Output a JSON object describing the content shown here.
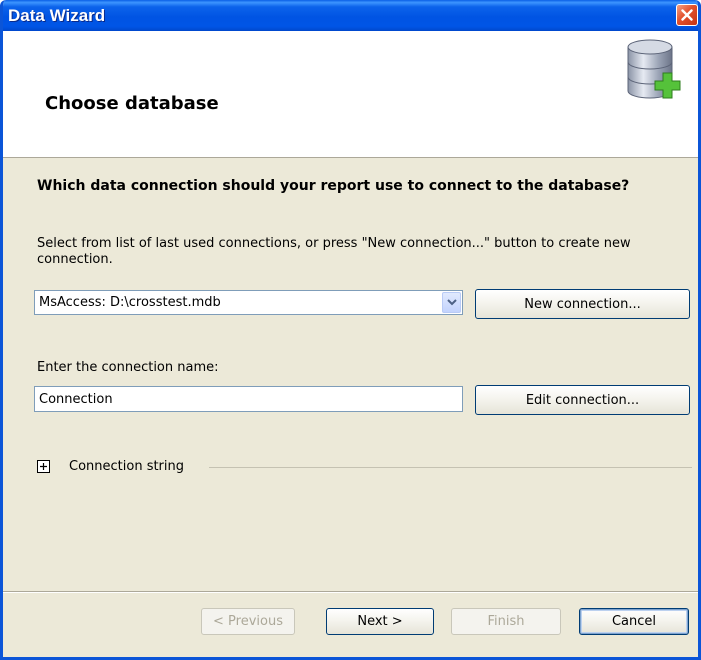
{
  "window": {
    "title": "Data Wizard"
  },
  "header": {
    "title": "Choose database",
    "icon": "database-add-icon"
  },
  "question": "Which data connection should your report use to connect to the database?",
  "hint": "Select from list of last used connections, or press \"New connection...\" button to create new connection.",
  "connection_select": {
    "value": "MsAccess: D:\\crosstest.mdb"
  },
  "new_connection_label": "New connection...",
  "connection_name": {
    "label": "Enter the connection name:",
    "value": "Connection"
  },
  "edit_connection_label": "Edit connection...",
  "connection_string_label": "Connection string",
  "footer": {
    "previous_label": "< Previous",
    "next_label": "Next >",
    "finish_label": "Finish",
    "cancel_label": "Cancel"
  },
  "colors": {
    "title_bar": "#0054E3",
    "dialog_bg": "#ECE9D8",
    "close_button": "#E2502C"
  }
}
